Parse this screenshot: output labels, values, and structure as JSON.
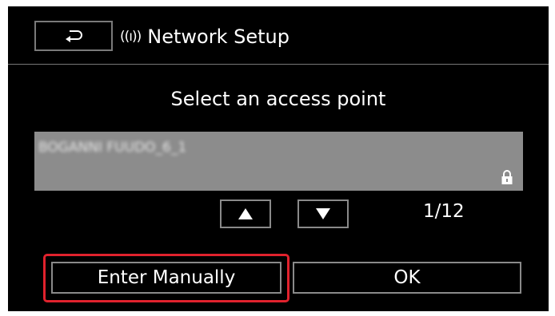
{
  "header": {
    "title": "Network Setup",
    "back_icon": "return-arrow-icon",
    "wifi_icon": "wifi-signal-icon"
  },
  "prompt": "Select an access point",
  "access_point": {
    "name": "BOGANNI FUUDO_6_1",
    "lock_icon": "lock-icon"
  },
  "pager": {
    "up_icon": "triangle-up-icon",
    "down_icon": "triangle-down-icon",
    "page_indicator": "1/12"
  },
  "buttons": {
    "enter_manually_label": "Enter Manually",
    "ok_label": "OK"
  },
  "colors": {
    "screen_bg": "#000000",
    "highlight": "#e0222d",
    "row_bg": "#8c8c8c",
    "border": "#8a8a8a"
  }
}
